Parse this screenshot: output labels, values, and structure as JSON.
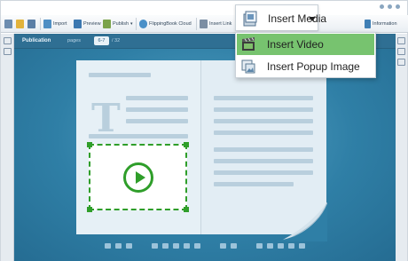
{
  "toolbar": {
    "import": "Import",
    "preview": "Preview",
    "publish": "Publish",
    "flippingbook_cloud": "FlippingBook Cloud",
    "insert_link": "Insert Link",
    "information": "Information"
  },
  "viewer": {
    "publication": "Publication",
    "pages_label": "pages",
    "current_pages": "6-7",
    "total_pages": "/ 32"
  },
  "insert_media": {
    "label": "Insert Media",
    "items": [
      {
        "label": "Insert Video",
        "highlighted": true
      },
      {
        "label": "Insert Popup Image",
        "highlighted": false
      }
    ]
  },
  "colors": {
    "highlight": "#77c36f",
    "video_frame": "#2f9e2a",
    "stage": "#2f7fa6"
  }
}
